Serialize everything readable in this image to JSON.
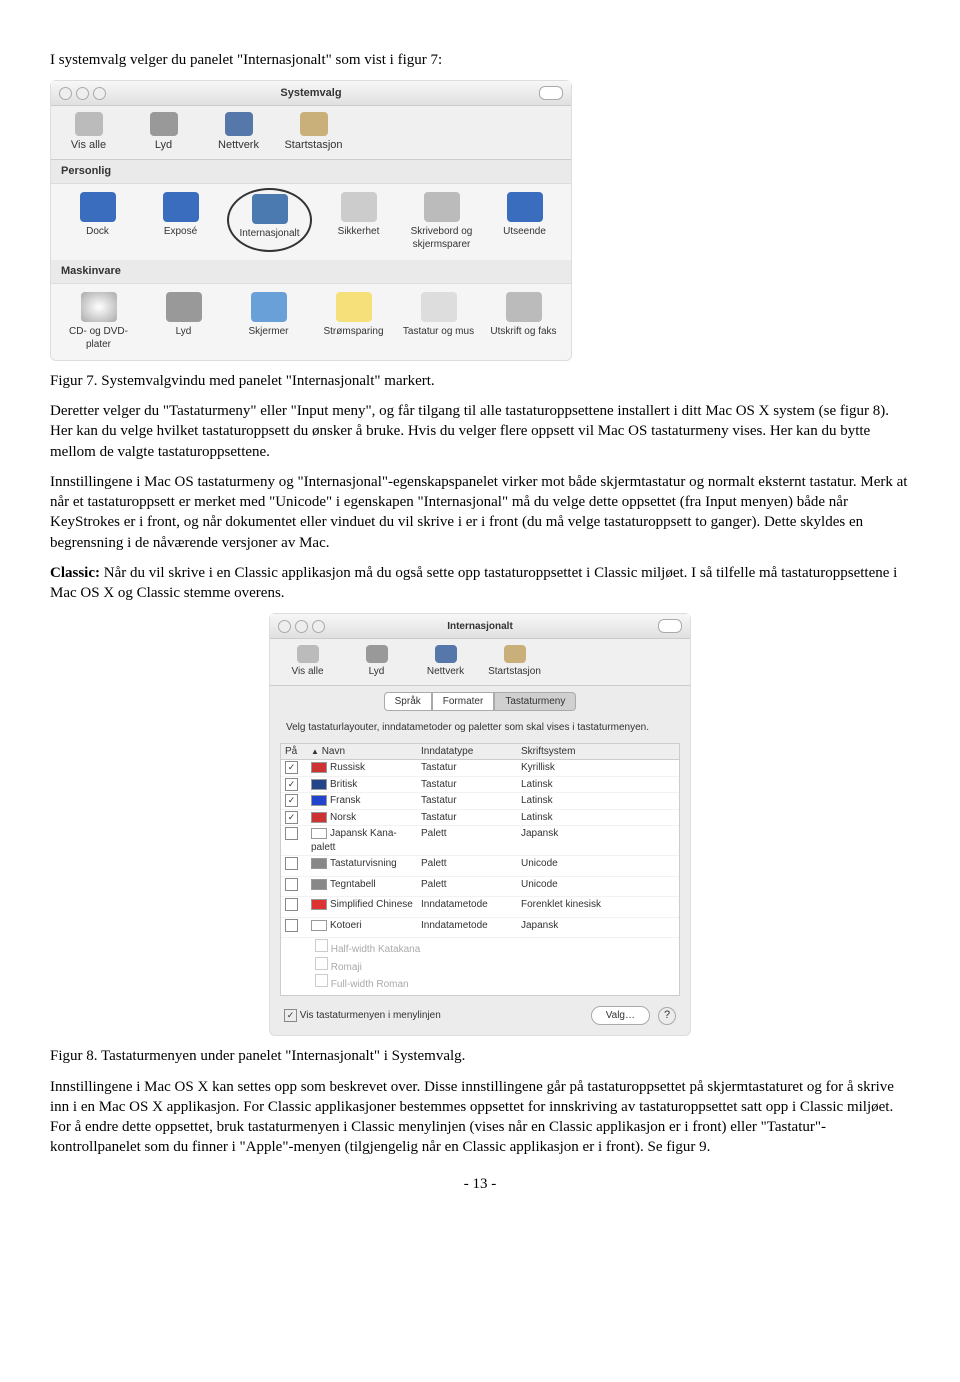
{
  "intro": "I systemvalg velger du panelet \"Internasjonalt\" som vist i figur 7:",
  "win1": {
    "title": "Systemvalg",
    "toolbar": [
      "Vis alle",
      "Lyd",
      "Nettverk",
      "Startstasjon"
    ],
    "sec1": "Personlig",
    "row1": [
      "Dock",
      "Exposé",
      "Internasjonalt",
      "Sikkerhet",
      "Skrivebord og skjermsparer",
      "Utseende"
    ],
    "sec2": "Maskinvare",
    "row2": [
      "CD- og DVD-plater",
      "Lyd",
      "Skjermer",
      "Strømsparing",
      "Tastatur og mus",
      "Utskrift og faks"
    ]
  },
  "fig7": "Figur 7. Systemvalgvindu med panelet \"Internasjonalt\" markert.",
  "para2": "Deretter velger du \"Tastaturmeny\" eller \"Input meny\", og får tilgang til alle tastaturoppsettene installert i ditt Mac OS X system (se figur 8). Her kan du velge hvilket tastaturoppsett du ønsker å bruke. Hvis du velger flere oppsett vil Mac OS tastaturmeny vises. Her kan du bytte mellom de valgte tastaturoppsettene.",
  "para3": "Innstillingene i Mac OS tastaturmeny og \"Internasjonal\"-egenskapspanelet virker mot både skjermtastatur og normalt eksternt tastatur. Merk at når et tastaturoppsett er merket med \"Unicode\" i egenskapen \"Internasjonal\" må du velge dette oppsettet (fra Input menyen) både når KeyStrokes er i front, og når dokumentet eller vinduet du vil skrive i er i front (du må velge tastaturoppsett to ganger). Dette skyldes en begrensning i de nåværende versjoner av Mac.",
  "para4a": "Classic:",
  "para4b": " Når du vil skrive i en Classic applikasjon må du også sette opp tastaturoppsettet i Classic miljøet. I så tilfelle må tastaturoppsettene i Mac OS X og Classic stemme overens.",
  "win2": {
    "title": "Internasjonalt",
    "toolbar": [
      "Vis alle",
      "Lyd",
      "Nettverk",
      "Startstasjon"
    ],
    "tabs": [
      "Språk",
      "Formater",
      "Tastaturmeny"
    ],
    "desc": "Velg tastaturlayouter, inndatametoder og paletter som skal vises i tastaturmenyen.",
    "head": [
      "På",
      "Navn",
      "Inndatatype",
      "Skriftsystem"
    ],
    "rows": [
      {
        "on": true,
        "flag": "#cc3333",
        "name": "Russisk",
        "type": "Tastatur",
        "sys": "Kyrillisk"
      },
      {
        "on": true,
        "flag": "#224488",
        "name": "Britisk",
        "type": "Tastatur",
        "sys": "Latinsk"
      },
      {
        "on": true,
        "flag": "#2244cc",
        "name": "Fransk",
        "type": "Tastatur",
        "sys": "Latinsk"
      },
      {
        "on": true,
        "flag": "#cc3333",
        "name": "Norsk",
        "type": "Tastatur",
        "sys": "Latinsk"
      },
      {
        "on": false,
        "flag": "#ffffff",
        "name": "Japansk Kana-palett",
        "type": "Palett",
        "sys": "Japansk"
      },
      {
        "on": false,
        "flag": "#888888",
        "name": "Tastaturvisning",
        "type": "Palett",
        "sys": "Unicode"
      },
      {
        "on": false,
        "flag": "#888888",
        "name": "Tegntabell",
        "type": "Palett",
        "sys": "Unicode"
      },
      {
        "on": false,
        "flag": "#dd3333",
        "name": "Simplified Chinese",
        "type": "Inndatametode",
        "sys": "Forenklet kinesisk"
      },
      {
        "on": false,
        "flag": "#ffffff",
        "name": "Kotoeri",
        "type": "Inndatametode",
        "sys": "Japansk"
      }
    ],
    "subrows": [
      "Half-width Katakana",
      "Romaji",
      "Full-width Roman"
    ],
    "showmenu": "Vis tastaturmenyen i menylinjen",
    "btn": "Valg…"
  },
  "fig8": "Figur 8. Tastaturmenyen under panelet \"Internasjonalt\" i Systemvalg.",
  "para5": "Innstillingene i Mac OS X kan settes opp som beskrevet over. Disse innstillingene går på tastaturoppsettet på skjermtastaturet og for å skrive inn i en Mac OS X applikasjon. For Classic applikasjoner bestemmes oppsettet for innskriving av tastaturoppsettet satt opp i Classic miljøet. For å endre dette oppsettet, bruk tastaturmenyen i Classic menylinjen (vises når en Classic applikasjon er i front) eller \"Tastatur\"-kontrollpanelet som du finner i \"Apple\"-menyen (tilgjengelig når en Classic applikasjon er i front). Se figur 9.",
  "pagenum": "- 13 -"
}
